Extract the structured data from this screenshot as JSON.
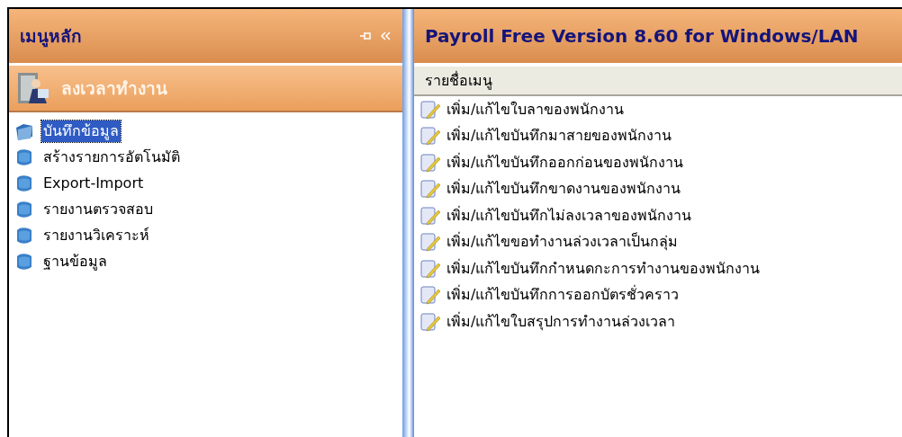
{
  "left_panel": {
    "title": "เมนูหลัก",
    "section": {
      "label": "ลงเวลาทำงาน"
    },
    "tree": [
      {
        "label": "บันทึกข้อมูล",
        "selected": true,
        "expanded": true
      },
      {
        "label": "สร้างรายการอัตโนมัติ",
        "selected": false,
        "expanded": false
      },
      {
        "label": "Export-Import",
        "selected": false,
        "expanded": false
      },
      {
        "label": "รายงานตรวจสอบ",
        "selected": false,
        "expanded": false
      },
      {
        "label": "รายงานวิเคราะห์",
        "selected": false,
        "expanded": false
      },
      {
        "label": "ฐานข้อมูล",
        "selected": false,
        "expanded": false
      }
    ]
  },
  "right_panel": {
    "title": "Payroll Free Version 8.60 for Windows/LAN",
    "column": "รายชื่อเมนู",
    "items": [
      "เพิ่ม/แก้ไขใบลาของพนักงาน",
      "เพิ่ม/แก้ไขบันทึกมาสายของพนักงาน",
      "เพิ่ม/แก้ไขบันทึกออกก่อนของพนักงาน",
      "เพิ่ม/แก้ไขบันทึกขาดงานของพนักงาน",
      "เพิ่ม/แก้ไขบันทึกไม่ลงเวลาของพนักงาน",
      "เพิ่ม/แก้ไขขอทำงานล่วงเวลาเป็นกลุ่ม",
      "เพิ่ม/แก้ไขบันทึกกำหนดกะการทำงานของพนักงาน",
      "เพิ่ม/แก้ไขบันทึกการออกบัตรชั่วคราว",
      "เพิ่ม/แก้ไขใบสรุปการทำงานล่วงเวลา"
    ]
  }
}
